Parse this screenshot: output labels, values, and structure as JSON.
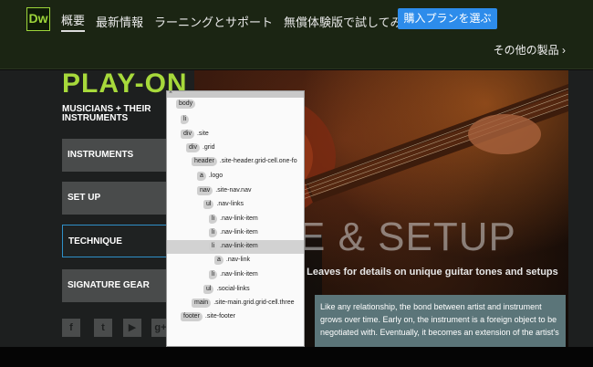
{
  "app": {
    "logo": "Dw",
    "nav": [
      "概要",
      "最新情報",
      "ラーニングとサポート",
      "無償体験版で試してみる"
    ],
    "buy_label": "購入プランを選ぶ",
    "other_products": "その他の製品 ›"
  },
  "site": {
    "brand_title": "PLAY-ON",
    "brand_subtitle": "MUSICIANS + THEIR INSTRUMENTS",
    "tabs": [
      "INSTRUMENTS",
      "SET UP",
      "TECHNIQUE",
      "SIGNATURE GEAR"
    ],
    "selected_tab": "TECHNIQUE",
    "hero_title": "E & SETUP",
    "hero_caption": "l Leaves for details on unique guitar tones and setups",
    "story_text": "Like any relationship, the bond between artist and instrument grows over time. Early on, the instrument is a foreign object to be negotiated with. Eventually, it becomes an extension of the artist's",
    "social_icons": [
      "facebook-icon",
      "twitter-icon",
      "youtube-icon",
      "google-plus-icon"
    ]
  },
  "inspector": {
    "close": "×",
    "rows": [
      {
        "tag": "body",
        "sel": "",
        "highlighted": false
      },
      {
        "tag": "li",
        "sel": "",
        "highlighted": false
      },
      {
        "tag": "div",
        "sel": ".site",
        "highlighted": false
      },
      {
        "tag": "div",
        "sel": ".grid",
        "highlighted": false
      },
      {
        "tag": "header",
        "sel": ".site-header.grid-cell.one-fo",
        "highlighted": false
      },
      {
        "tag": "a",
        "sel": ".logo",
        "highlighted": false
      },
      {
        "tag": "nav",
        "sel": ".site-nav.nav",
        "highlighted": false
      },
      {
        "tag": "ul",
        "sel": ".nav-links",
        "highlighted": false
      },
      {
        "tag": "li",
        "sel": ".nav-link-item",
        "highlighted": false
      },
      {
        "tag": "li",
        "sel": ".nav-link-item",
        "highlighted": false
      },
      {
        "tag": "li",
        "sel": ".nav-link-item",
        "highlighted": true
      },
      {
        "tag": "a",
        "sel": ".nav-link",
        "highlighted": false
      },
      {
        "tag": "li",
        "sel": ".nav-link-item",
        "highlighted": false
      },
      {
        "tag": "ul",
        "sel": ".social-links",
        "highlighted": false
      },
      {
        "tag": "main",
        "sel": ".site-main.grid.grid-cell.three",
        "highlighted": false
      },
      {
        "tag": "footer",
        "sel": ".site-footer",
        "highlighted": false
      }
    ]
  }
}
